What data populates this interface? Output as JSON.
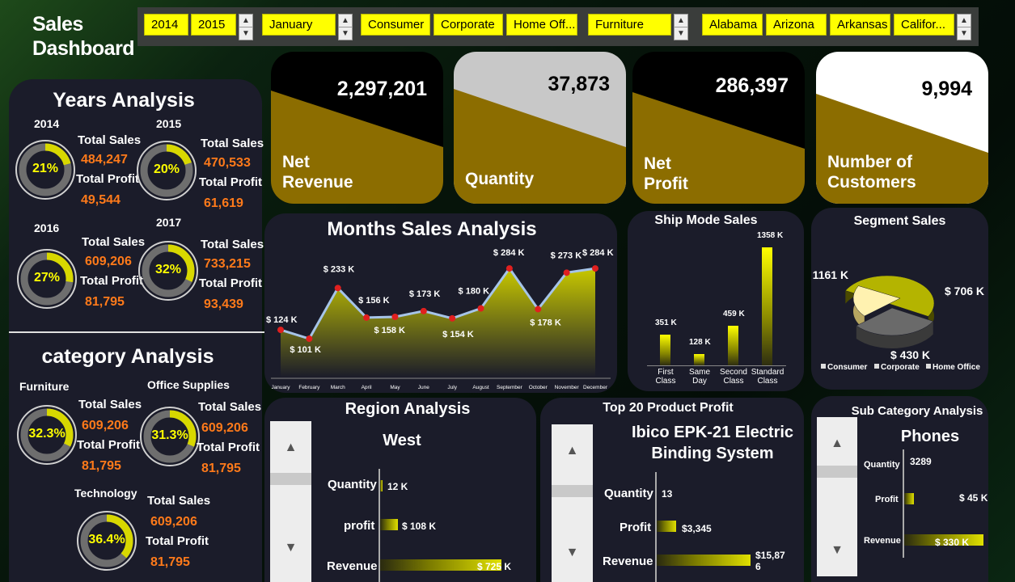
{
  "dashboard_title_line1": "Sales",
  "dashboard_title_line2": "Dashboard",
  "filters": {
    "years": [
      "2014",
      "2015"
    ],
    "month": "January",
    "segments": [
      "Consumer",
      "Corporate",
      "Home Off..."
    ],
    "category": "Furniture",
    "states": [
      "Alabama",
      "Arizona",
      "Arkansas",
      "Califor..."
    ]
  },
  "kpis": [
    {
      "value": "2,297,201",
      "label1": "Net",
      "label2": "Revenue",
      "top_color": "#000000"
    },
    {
      "value": "37,873",
      "label1": "",
      "label2": "Quantity",
      "top_color": "#c8c8c8"
    },
    {
      "value": "286,397",
      "label1": "Net",
      "label2": "Profit",
      "top_color": "#000000"
    },
    {
      "value": "9,994",
      "label1": "Number of",
      "label2": "Customers",
      "top_color": "#ffffff"
    }
  ],
  "years_analysis": {
    "title": "Years Analysis",
    "total_sales_label": "Total Sales",
    "total_profit_label": "Total Profit",
    "items": [
      {
        "year": "2014",
        "pct": "21%",
        "fraction": 0.21,
        "sales": "484,247",
        "profit": "49,544"
      },
      {
        "year": "2015",
        "pct": "20%",
        "fraction": 0.2,
        "sales": "470,533",
        "profit": "61,619"
      },
      {
        "year": "2016",
        "pct": "27%",
        "fraction": 0.27,
        "sales": "609,206",
        "profit": "81,795"
      },
      {
        "year": "2017",
        "pct": "32%",
        "fraction": 0.32,
        "sales": "733,215",
        "profit": "93,439"
      }
    ]
  },
  "category_analysis": {
    "title": "category Analysis",
    "items": [
      {
        "name": "Furniture",
        "pct": "32.3%",
        "fraction": 0.323,
        "sales": "609,206",
        "profit": "81,795"
      },
      {
        "name": "Office Supplies",
        "pct": "31.3%",
        "fraction": 0.313,
        "sales": "609,206",
        "profit": "81,795"
      },
      {
        "name": "Technology",
        "pct": "36.4%",
        "fraction": 0.364,
        "sales": "609,206",
        "profit": "81,795"
      }
    ]
  },
  "months": {
    "title": "Months Sales Analysis",
    "labels": [
      "January",
      "February",
      "March",
      "April",
      "May",
      "June",
      "July",
      "August",
      "September",
      "October",
      "November",
      "December"
    ],
    "data_labels": [
      "$ 124 K",
      "$ 101 K",
      "$ 233 K",
      "$ 156 K",
      "$ 158 K",
      "$ 173 K",
      "$ 154 K",
      "$ 180 K",
      "$ 284 K",
      "$ 178 K",
      "$ 273 K",
      "$ 284 K"
    ]
  },
  "ship_mode": {
    "title": "Ship Mode Sales",
    "labels": [
      "First Class",
      "Same Day",
      "Second Class",
      "Standard Class"
    ],
    "data_labels": [
      "351 K",
      "128 K",
      "459 K",
      "1358 K"
    ]
  },
  "segment": {
    "title": "Segment Sales",
    "data_labels": [
      "$ 1161 K",
      "$ 706 K",
      "$ 430 K"
    ],
    "legend": [
      "Consumer",
      "Corporate",
      "Home Office"
    ]
  },
  "region": {
    "title": "Region Analysis",
    "selected": "West",
    "rows": [
      {
        "label": "Quantity",
        "value": "12 K"
      },
      {
        "label": "profit",
        "value": "$ 108 K"
      },
      {
        "label": "Revenue",
        "value": "$ 725 K"
      }
    ]
  },
  "product": {
    "title": "Top 20 Product Profit",
    "name_line1": "Ibico EPK-21 Electric",
    "name_line2": "Binding System",
    "rows": [
      {
        "label": "Quantity",
        "value": "13"
      },
      {
        "label": "Profit",
        "value": "$3,345"
      },
      {
        "label": "Revenue",
        "value": "$15,87\n6"
      }
    ]
  },
  "subcategory": {
    "title": "Sub Category Analysis",
    "selected": "Phones",
    "rows": [
      {
        "label": "Quantity",
        "value": "3289"
      },
      {
        "label": "Profit",
        "value": "$ 45 K"
      },
      {
        "label": "Revenue",
        "value": "$ 330 K"
      }
    ]
  },
  "chart_data": [
    {
      "type": "area",
      "title": "Months Sales Analysis",
      "categories": [
        "January",
        "February",
        "March",
        "April",
        "May",
        "June",
        "July",
        "August",
        "September",
        "October",
        "November",
        "December"
      ],
      "values": [
        124,
        101,
        233,
        156,
        158,
        173,
        154,
        180,
        284,
        178,
        273,
        284
      ]
    },
    {
      "type": "bar",
      "title": "Ship Mode Sales",
      "categories": [
        "First Class",
        "Same Day",
        "Second Class",
        "Standard Class"
      ],
      "values": [
        351,
        128,
        459,
        1358
      ]
    },
    {
      "type": "pie",
      "title": "Segment Sales",
      "categories": [
        "Consumer",
        "Corporate",
        "Home Office"
      ],
      "values": [
        1161,
        706,
        430
      ]
    }
  ],
  "colors": {
    "accent": "#ffff00",
    "gold": "#8c6d00",
    "orange": "#ff7a1a",
    "panel": "#1b1c2a"
  }
}
